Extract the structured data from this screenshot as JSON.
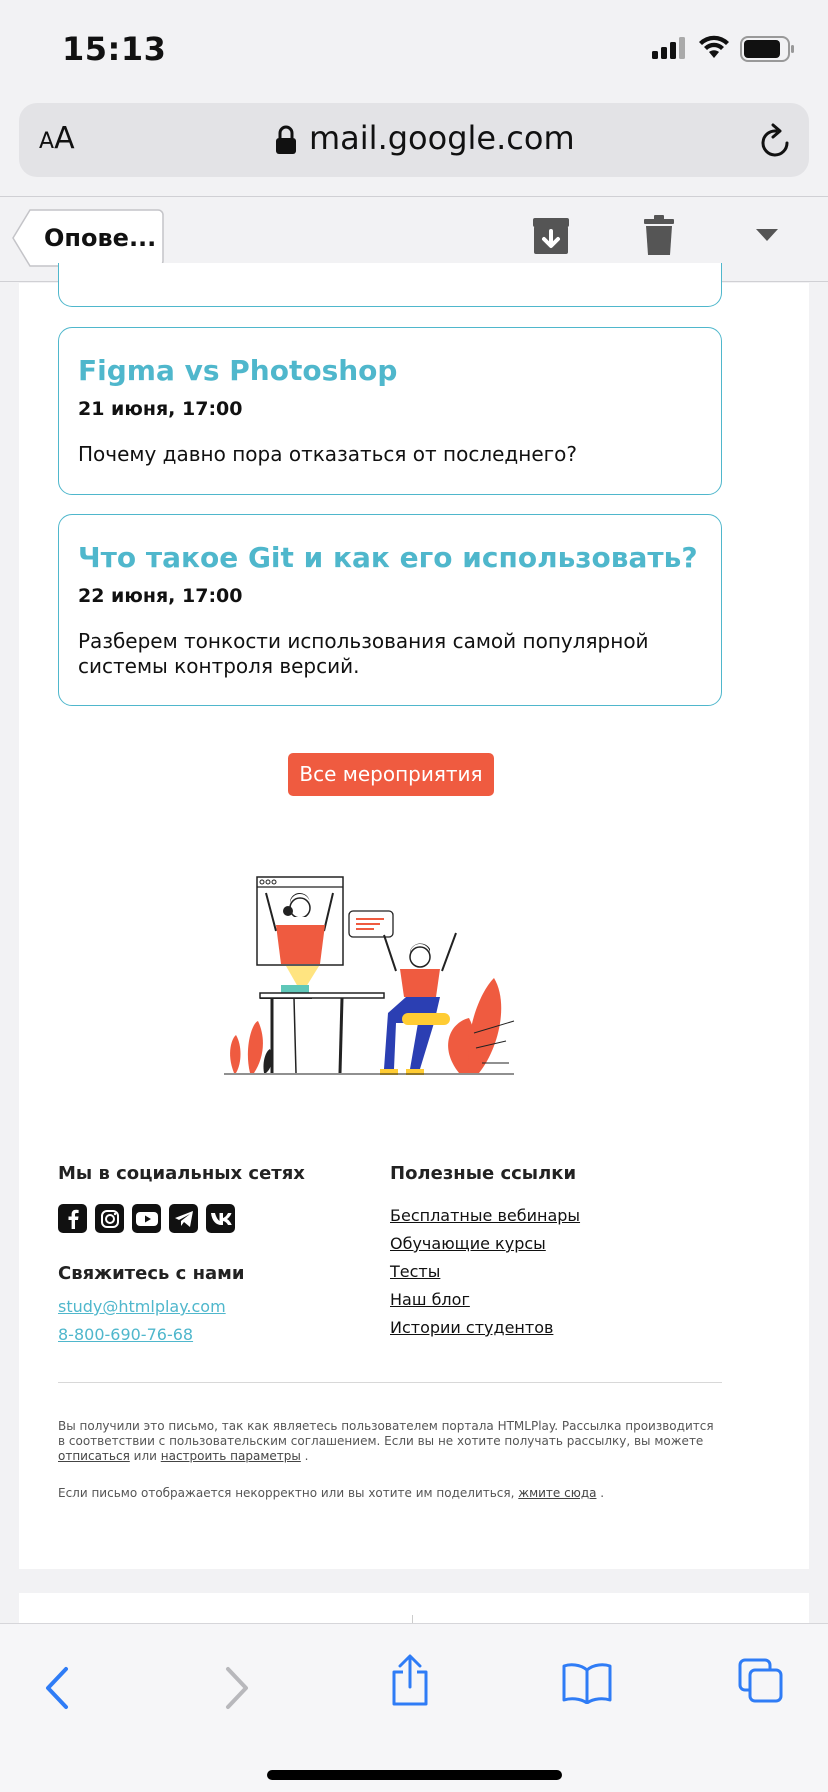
{
  "status_bar": {
    "time": "15:13"
  },
  "browser": {
    "text_size_label": "AA",
    "url": "mail.google.com"
  },
  "mail_toolbar": {
    "back_label": "Опове...",
    "icons": [
      "archive-icon",
      "trash-icon",
      "chevron-down-icon"
    ]
  },
  "events": [
    {
      "title": "Figma vs Photoshop",
      "date": "21 июня, 17:00",
      "description": "Почему давно пора отказаться от последнего?"
    },
    {
      "title": "Что такое Git и как его использовать?",
      "date": "22 июня, 17:00",
      "description": "Разберем тонкости использования самой популярной системы контроля версий."
    }
  ],
  "all_events_button": "Все мероприятия",
  "footer": {
    "social_heading": "Мы в социальных сетях",
    "social_icons": [
      "facebook-icon",
      "instagram-icon",
      "youtube-icon",
      "telegram-icon",
      "vk-icon"
    ],
    "contact_heading": "Свяжитесь с нами",
    "email": "study@htmlplay.com",
    "phone": "8-800-690-76-68",
    "links_heading": "Полезные ссылки",
    "links": [
      "Бесплатные вебинары",
      "Обучающие курсы",
      "Тесты",
      "Наш блог",
      "Истории студентов"
    ]
  },
  "legal": {
    "line1_prefix": "Вы получили это письмо, так как являетесь пользователем портала HTMLPlay. Рассылка производится в соответствии с пользовательским соглашением. Если вы не хотите получать рассылку, вы можете",
    "unsubscribe": "отписаться",
    "or": "или",
    "settings": "настроить параметры",
    "line2_prefix": "Если письмо отображается некорректно или вы хотите им поделиться,",
    "click_here": "жмите сюда"
  },
  "colors": {
    "accent": "#4fb7cc",
    "button": "#ef5b40",
    "ios_blue": "#2f7cf6"
  }
}
